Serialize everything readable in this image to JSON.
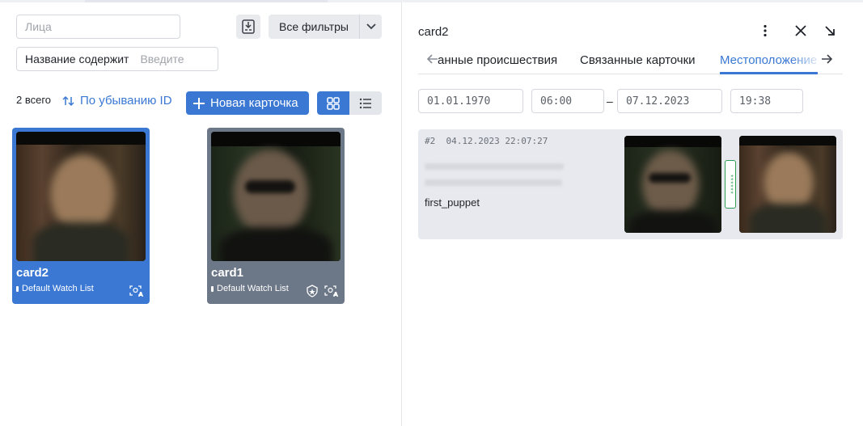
{
  "toolbar": {
    "face_search_placeholder": "Лица",
    "all_filters_label": "Все фильтры",
    "name_filter_label": "Название содержит",
    "name_filter_placeholder": "Введите"
  },
  "list": {
    "total_label": "2 всего",
    "sort_label": "По убыванию ID",
    "new_card_label": "Новая карточка"
  },
  "cards": [
    {
      "title": "card2",
      "watch_list": "Default Watch List",
      "selected": true
    },
    {
      "title": "card1",
      "watch_list": "Default Watch List",
      "selected": false
    }
  ],
  "detail": {
    "title": "card2",
    "tabs": [
      "анные происшествия",
      "Связанные карточки",
      "Местоположение"
    ],
    "active_tab": "Местоположение",
    "date_from": "01.01.1970",
    "time_from": "06:00",
    "date_to": "07.12.2023",
    "time_to": "19:38",
    "event": {
      "id": "#2",
      "timestamp": "04.12.2023 22:07:27",
      "label": "first_puppet",
      "score_text": "******"
    }
  },
  "colors": {
    "accent": "#3a78d4",
    "card_unselected": "#6c7787",
    "match_green": "#2f9d55"
  }
}
